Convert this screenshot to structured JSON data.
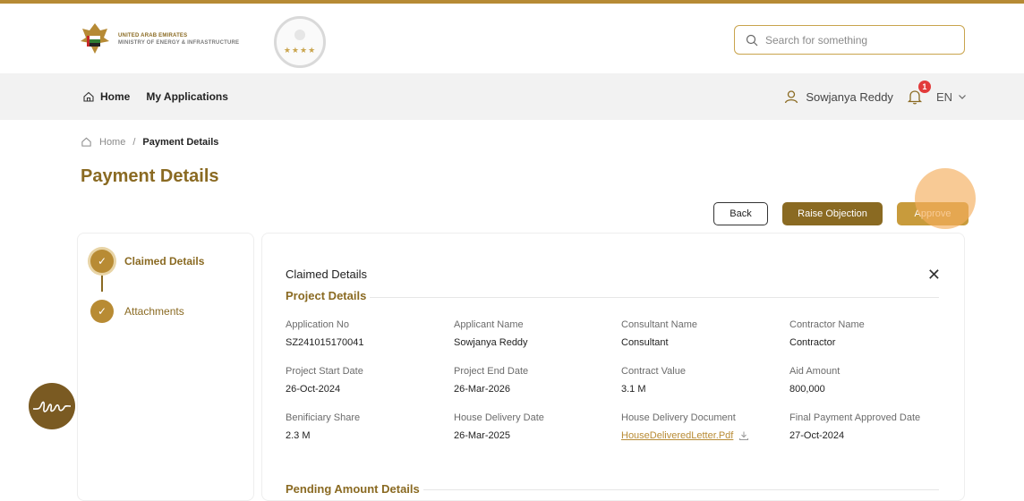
{
  "header": {
    "logo_line1": "UNITED ARAB EMIRATES",
    "logo_line2": "MINISTRY OF ENERGY & INFRASTRUCTURE",
    "search_placeholder": "Search for something"
  },
  "nav": {
    "home": "Home",
    "my_applications": "My Applications",
    "user_name": "Sowjanya Reddy",
    "notification_count": "1",
    "language": "EN"
  },
  "breadcrumb": {
    "home": "Home",
    "separator": "/",
    "current": "Payment Details"
  },
  "page": {
    "title": "Payment Details"
  },
  "actions": {
    "back": "Back",
    "raise_objection": "Raise Objection",
    "approve": "Approve"
  },
  "steps": [
    {
      "label": "Claimed Details"
    },
    {
      "label": "Attachments"
    }
  ],
  "details": {
    "section": "Claimed Details",
    "project_heading": "Project Details",
    "fields": [
      {
        "label": "Application No",
        "value": "SZ241015170041"
      },
      {
        "label": "Applicant Name",
        "value": "Sowjanya Reddy"
      },
      {
        "label": "Consultant Name",
        "value": "Consultant"
      },
      {
        "label": "Contractor Name",
        "value": "Contractor"
      },
      {
        "label": "Project Start Date",
        "value": "26-Oct-2024"
      },
      {
        "label": "Project End Date",
        "value": "26-Mar-2026"
      },
      {
        "label": "Contract Value",
        "value": "3.1 M"
      },
      {
        "label": "Aid Amount",
        "value": "800,000"
      },
      {
        "label": "Benificiary Share",
        "value": "2.3 M"
      },
      {
        "label": "House Delivery Date",
        "value": "26-Mar-2025"
      },
      {
        "label": "House Delivery Document",
        "value": "HouseDeliveredLetter.Pdf"
      },
      {
        "label": "Final Payment Approved Date",
        "value": "27-Oct-2024"
      }
    ],
    "pending_heading": "Pending Amount Details"
  },
  "colors": {
    "brand": "#b68a35",
    "brand_dark": "#8a6a22",
    "badge": "#e23b3b"
  }
}
